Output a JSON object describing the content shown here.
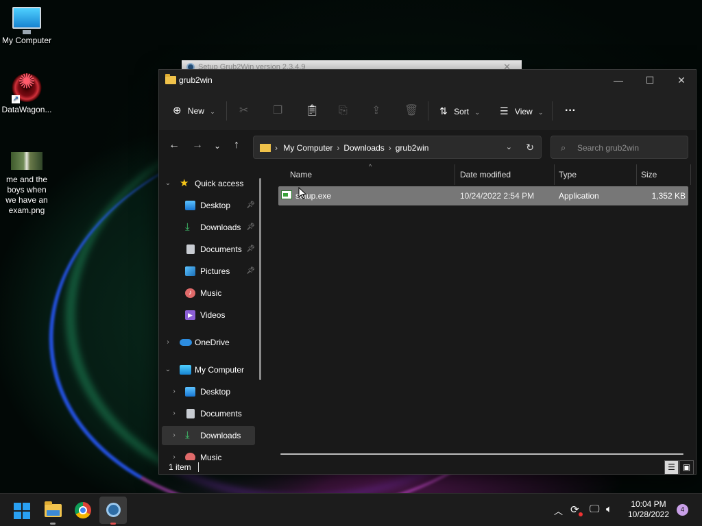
{
  "desktop": {
    "icons": [
      {
        "label": "My Computer"
      },
      {
        "label": "DataWagon..."
      },
      {
        "label": "me and the boys when we have an exam.png"
      }
    ]
  },
  "background_window": {
    "title": "Setup Grub2Win version 2.3.4.9"
  },
  "explorer": {
    "title": "grub2win",
    "toolbar": {
      "new_label": "New",
      "sort_label": "Sort",
      "view_label": "View",
      "more_label": "···"
    },
    "address": {
      "crumbs": [
        "My Computer",
        "Downloads",
        "grub2win"
      ]
    },
    "search": {
      "placeholder": "Search grub2win"
    },
    "nav": {
      "quick_access": "Quick access",
      "qa_items": [
        "Desktop",
        "Downloads",
        "Documents",
        "Pictures",
        "Music",
        "Videos"
      ],
      "onedrive": "OneDrive",
      "my_computer": "My Computer",
      "pc_items": [
        "Desktop",
        "Documents",
        "Downloads",
        "Music"
      ]
    },
    "columns": {
      "name": "Name",
      "date": "Date modified",
      "type": "Type",
      "size": "Size"
    },
    "files": [
      {
        "name": "setup.exe",
        "date": "10/24/2022 2:54 PM",
        "type": "Application",
        "size": "1,352 KB"
      }
    ],
    "status": {
      "count": "1 item"
    }
  },
  "taskbar": {
    "time": "10:04 PM",
    "date": "10/28/2022",
    "notifications": "4"
  },
  "colors": {
    "accent": "#29a0f2",
    "folder": "#f0c24a",
    "window_bg": "#191919",
    "selection": "#777777"
  }
}
